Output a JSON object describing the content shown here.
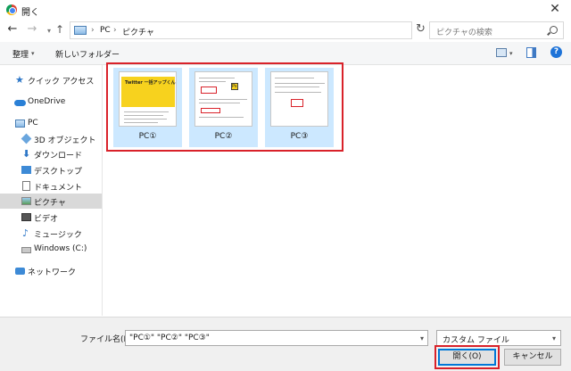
{
  "window": {
    "title": "開く"
  },
  "address": {
    "crumb_sep": "›",
    "crumbs": [
      "PC",
      "ピクチャ"
    ]
  },
  "search": {
    "placeholder": "ピクチャの検索"
  },
  "toolbar": {
    "organize_label": "整理",
    "new_folder_label": "新しいフォルダー",
    "help_label": "?"
  },
  "sidebar": {
    "items": [
      {
        "label": "クイック アクセス",
        "icon": "star-icon"
      },
      {
        "label": "OneDrive",
        "icon": "cloud-icon"
      },
      {
        "label": "PC",
        "icon": "pc-icon"
      },
      {
        "label": "3D オブジェクト",
        "icon": "cube-icon"
      },
      {
        "label": "ダウンロード",
        "icon": "download-icon"
      },
      {
        "label": "デスクトップ",
        "icon": "desktop-icon"
      },
      {
        "label": "ドキュメント",
        "icon": "document-icon"
      },
      {
        "label": "ピクチャ",
        "icon": "pictures-icon",
        "selected": true
      },
      {
        "label": "ビデオ",
        "icon": "video-icon"
      },
      {
        "label": "ミュージック",
        "icon": "music-icon"
      },
      {
        "label": "Windows (C:)",
        "icon": "drive-icon"
      },
      {
        "label": "ネットワーク",
        "icon": "network-icon"
      }
    ]
  },
  "files": [
    {
      "name": "PC①",
      "selected": true,
      "thumb_title": "Twitter 一括アップくん"
    },
    {
      "name": "PC②",
      "selected": true,
      "thumb_badge": "Ps"
    },
    {
      "name": "PC③",
      "selected": true
    }
  ],
  "footer": {
    "filename_label": "ファイル名(N):",
    "filename_value": "\"PC①\" \"PC②\" \"PC③\"",
    "filter_value": "カスタム ファイル",
    "open_label": "開く(O)",
    "cancel_label": "キャンセル"
  },
  "colors": {
    "selection": "#cce8ff",
    "highlight": "#d9222a",
    "accent": "#0078d7"
  }
}
